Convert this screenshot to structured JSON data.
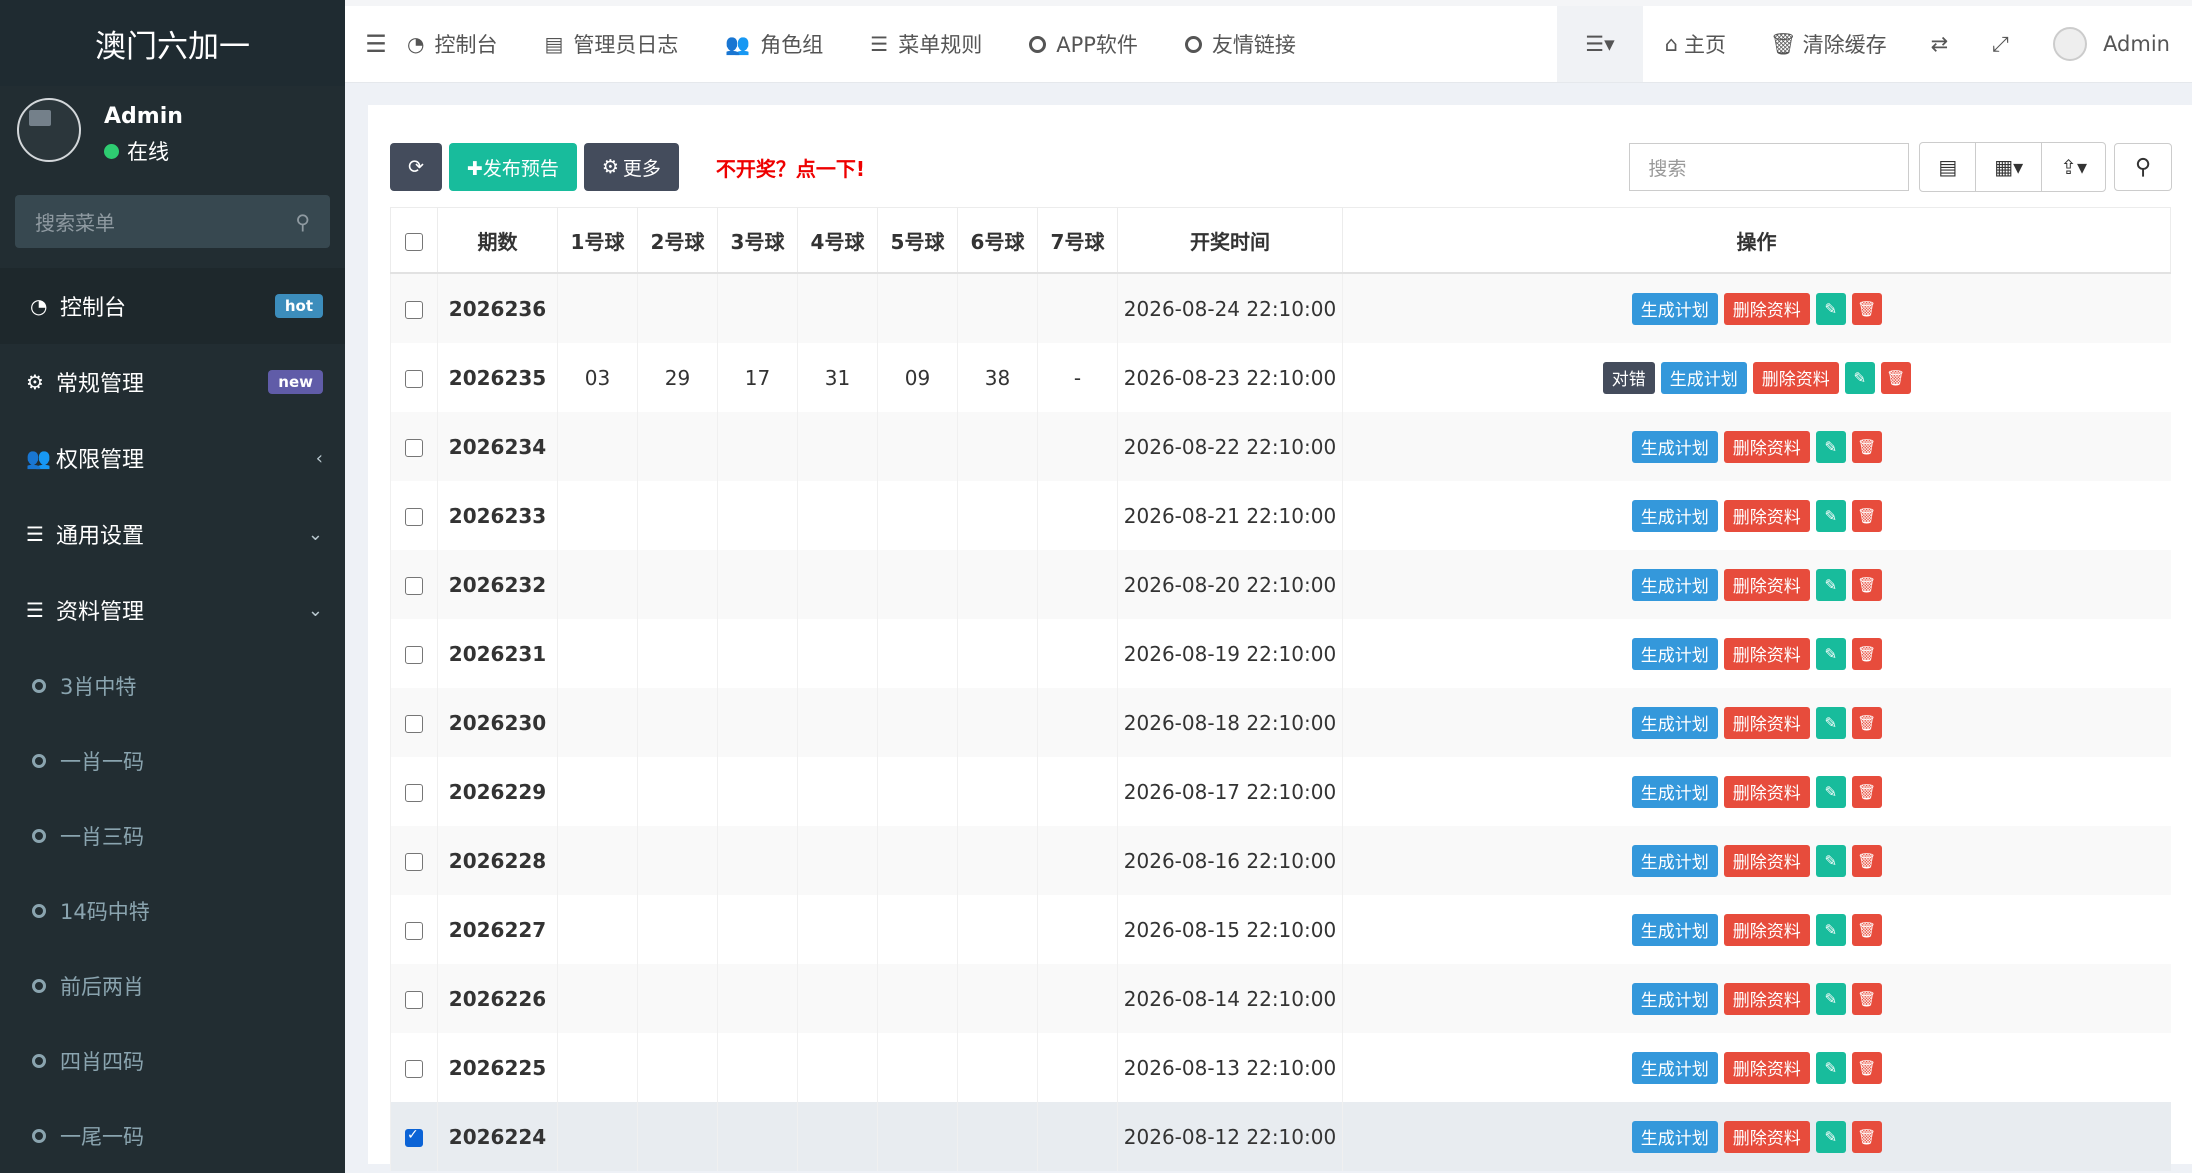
{
  "app": {
    "title": "澳门六加一"
  },
  "user": {
    "name": "Admin",
    "status": "在线"
  },
  "sidebar": {
    "search_placeholder": "搜索菜单",
    "items": [
      {
        "label": "控制台",
        "badge": "hot",
        "icon": "dashboard-icon"
      },
      {
        "label": "常规管理",
        "badge": "new",
        "icon": "cogs-icon"
      },
      {
        "label": "权限管理",
        "chevron": "‹",
        "icon": "users-icon"
      },
      {
        "label": "通用设置",
        "chevron": "⌄",
        "icon": "list-icon"
      },
      {
        "label": "资料管理",
        "chevron": "⌄",
        "icon": "list-icon"
      }
    ],
    "subitems": [
      "3肖中特",
      "一肖一码",
      "一肖三码",
      "14码中特",
      "前后两肖",
      "四肖四码",
      "一尾一码"
    ]
  },
  "topnav": {
    "tabs": [
      "控制台",
      "管理员日志",
      "角色组",
      "菜单规则",
      "APP软件",
      "友情链接"
    ],
    "home": "主页",
    "clear_cache": "清除缓存",
    "admin": "Admin"
  },
  "toolbar": {
    "publish": "✚发布预告",
    "more": "更多",
    "notice": "不开奖？点一下!",
    "search_placeholder": "搜索"
  },
  "table": {
    "headers": [
      "期数",
      "1号球",
      "2号球",
      "3号球",
      "4号球",
      "5号球",
      "6号球",
      "7号球",
      "开奖时间",
      "操作"
    ],
    "op_labels": {
      "correct": "对错",
      "plan": "生成计划",
      "delete": "删除资料"
    },
    "rows": [
      {
        "period": "2026236",
        "balls": [
          "",
          "",
          "",
          "",
          "",
          "",
          ""
        ],
        "time": "2026-08-24 22:10:00",
        "checked": false,
        "correct": false
      },
      {
        "period": "2026235",
        "balls": [
          "03",
          "29",
          "17",
          "31",
          "09",
          "38",
          "-"
        ],
        "time": "2026-08-23 22:10:00",
        "checked": false,
        "correct": true
      },
      {
        "period": "2026234",
        "balls": [
          "",
          "",
          "",
          "",
          "",
          "",
          ""
        ],
        "time": "2026-08-22 22:10:00",
        "checked": false,
        "correct": false
      },
      {
        "period": "2026233",
        "balls": [
          "",
          "",
          "",
          "",
          "",
          "",
          ""
        ],
        "time": "2026-08-21 22:10:00",
        "checked": false,
        "correct": false
      },
      {
        "period": "2026232",
        "balls": [
          "",
          "",
          "",
          "",
          "",
          "",
          ""
        ],
        "time": "2026-08-20 22:10:00",
        "checked": false,
        "correct": false
      },
      {
        "period": "2026231",
        "balls": [
          "",
          "",
          "",
          "",
          "",
          "",
          ""
        ],
        "time": "2026-08-19 22:10:00",
        "checked": false,
        "correct": false
      },
      {
        "period": "2026230",
        "balls": [
          "",
          "",
          "",
          "",
          "",
          "",
          ""
        ],
        "time": "2026-08-18 22:10:00",
        "checked": false,
        "correct": false
      },
      {
        "period": "2026229",
        "balls": [
          "",
          "",
          "",
          "",
          "",
          "",
          ""
        ],
        "time": "2026-08-17 22:10:00",
        "checked": false,
        "correct": false
      },
      {
        "period": "2026228",
        "balls": [
          "",
          "",
          "",
          "",
          "",
          "",
          ""
        ],
        "time": "2026-08-16 22:10:00",
        "checked": false,
        "correct": false
      },
      {
        "period": "2026227",
        "balls": [
          "",
          "",
          "",
          "",
          "",
          "",
          ""
        ],
        "time": "2026-08-15 22:10:00",
        "checked": false,
        "correct": false
      },
      {
        "period": "2026226",
        "balls": [
          "",
          "",
          "",
          "",
          "",
          "",
          ""
        ],
        "time": "2026-08-14 22:10:00",
        "checked": false,
        "correct": false
      },
      {
        "period": "2026225",
        "balls": [
          "",
          "",
          "",
          "",
          "",
          "",
          ""
        ],
        "time": "2026-08-13 22:10:00",
        "checked": false,
        "correct": false
      },
      {
        "period": "2026224",
        "balls": [
          "",
          "",
          "",
          "",
          "",
          "",
          ""
        ],
        "time": "2026-08-12 22:10:00",
        "checked": true,
        "correct": false
      }
    ]
  }
}
